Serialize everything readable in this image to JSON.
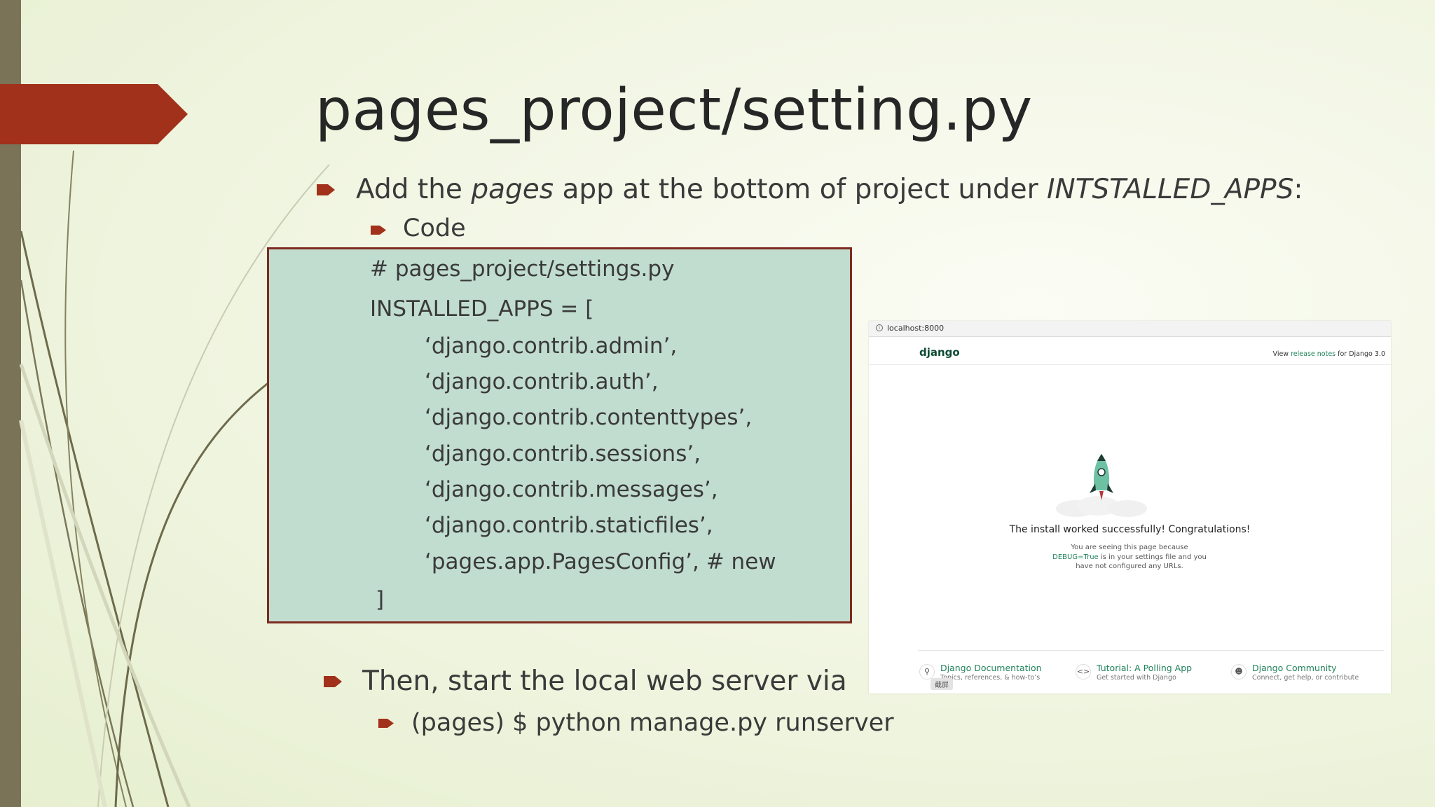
{
  "slide": {
    "title": "pages_project/setting.py",
    "bullet1": {
      "parts": [
        "Add the ",
        "pages",
        " app at the bottom of project under ",
        "INTSTALLED_APPS",
        ":"
      ]
    },
    "bullet1_sub": "Code",
    "code_lines": [
      "# pages_project/settings.py",
      "INSTALLED_APPS = [",
      "‘django.contrib.admin’,",
      "‘django.contrib.auth’,",
      "‘django.contrib.contenttypes’,",
      "‘django.contrib.sessions’,",
      "‘django.contrib.messages’,",
      "‘django.contrib.staticfiles’,",
      "‘pages.app.PagesConfig’, # new",
      "]"
    ],
    "bullet2": "Then, start the local web server via",
    "bullet2_sub": "(pages) $ python manage.py runserver",
    "colors": {
      "accent": "#a1311a",
      "code_bg": "#c1ddd0",
      "code_border": "#7e2a1e",
      "sidebar": "#7a7358"
    }
  },
  "browser": {
    "url": "localhost:8000",
    "logo": "django",
    "release_prefix": "View ",
    "release_link": "release notes",
    "release_suffix": " for Django 3.0",
    "headline": "The install worked successfully! Congratulations!",
    "info_1": "You are seeing this page because ",
    "info_debug": "DEBUG=True",
    "info_2": " is in your settings file and you have not configured any URLs.",
    "footer": [
      {
        "icon": "lightbulb-icon",
        "title": "Django Documentation",
        "subtitle": "Topics, references, & how-to’s"
      },
      {
        "icon": "code-brackets-icon",
        "title": "Tutorial: A Polling App",
        "subtitle": "Get started with Django"
      },
      {
        "icon": "people-icon",
        "title": "Django Community",
        "subtitle": "Connect, get help, or contribute"
      }
    ],
    "screenshot_tag": "截屏",
    "accent_color": "#20825b",
    "logo_color": "#0c4b33"
  }
}
